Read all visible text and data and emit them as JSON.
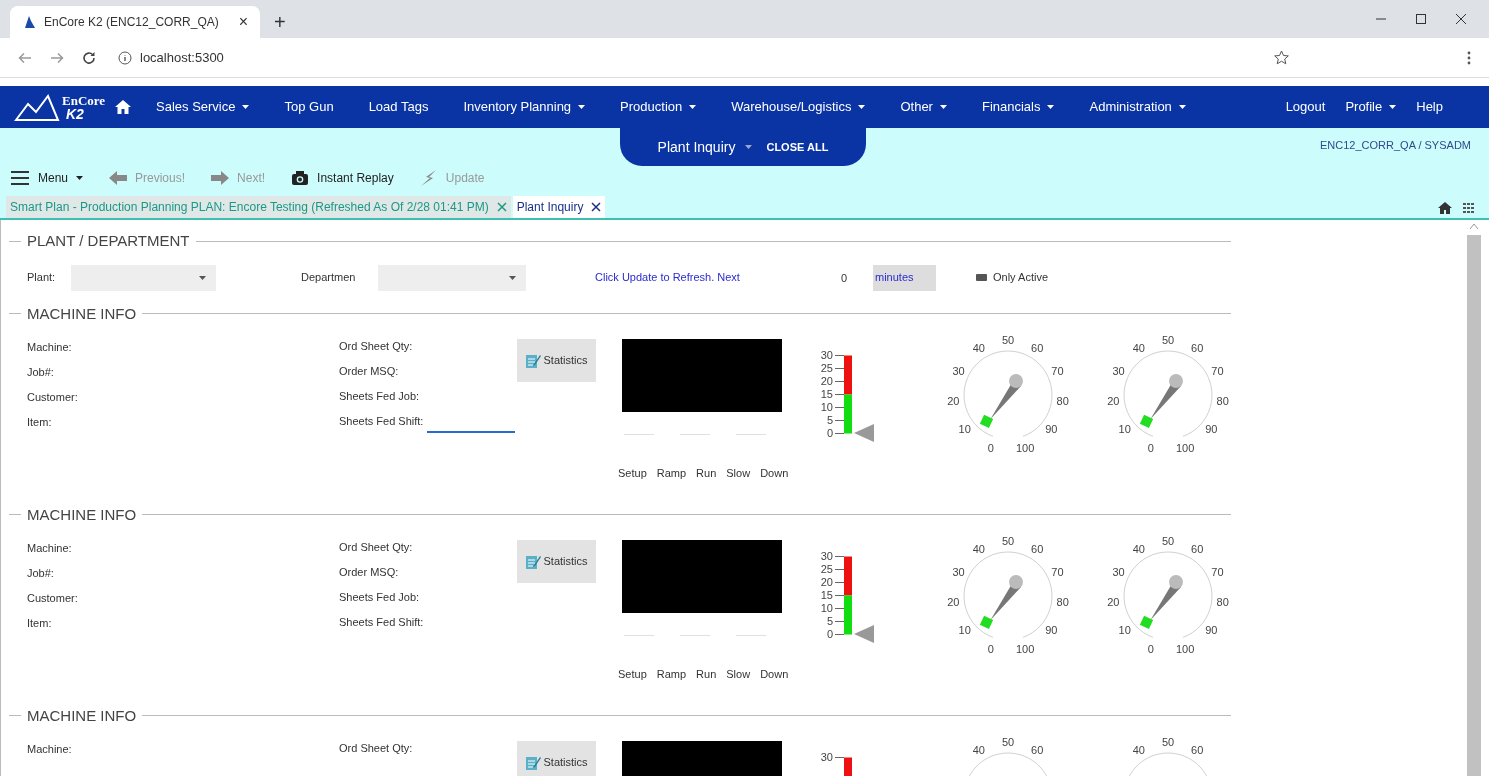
{
  "browser": {
    "tab_title": "EnCore K2 (ENC12_CORR_QA)",
    "tab_close": "×",
    "new_tab": "+",
    "address": "localhost:5300"
  },
  "nav": {
    "logo_text": "EnCore",
    "logo_sub": "K2",
    "items": [
      {
        "label": "Sales Service",
        "dropdown": true
      },
      {
        "label": "Top Gun",
        "dropdown": false
      },
      {
        "label": "Load Tags",
        "dropdown": false
      },
      {
        "label": "Inventory Planning",
        "dropdown": true
      },
      {
        "label": "Production",
        "dropdown": true
      },
      {
        "label": "Warehouse/Logistics",
        "dropdown": true
      },
      {
        "label": "Other",
        "dropdown": true
      },
      {
        "label": "Financials",
        "dropdown": true
      },
      {
        "label": "Administration",
        "dropdown": true
      }
    ],
    "right_items": [
      {
        "label": "Logout",
        "dropdown": false
      },
      {
        "label": "Profile",
        "dropdown": true
      },
      {
        "label": "Help",
        "dropdown": false
      }
    ]
  },
  "screen_pill": {
    "title": "Plant Inquiry",
    "close_all": "CLOSE ALL"
  },
  "user": "ENC12_CORR_QA / SYSADM",
  "toolbar": [
    {
      "kind": "menu",
      "label": "Menu",
      "disabled": false
    },
    {
      "kind": "previous",
      "label": "Previous!",
      "disabled": true
    },
    {
      "kind": "next",
      "label": "Next!",
      "disabled": true
    },
    {
      "kind": "camera",
      "label": "Instant Replay",
      "disabled": false
    },
    {
      "kind": "update",
      "label": "Update",
      "disabled": true
    }
  ],
  "tabs": [
    {
      "label": "Smart Plan - Production Planning PLAN: Encore Testing (Refreshed As Of 2/28 01:41 PM)",
      "selected": false
    },
    {
      "label": "Plant Inquiry",
      "selected": true
    }
  ],
  "plant_department": {
    "title": "PLANT / DEPARTMENT",
    "plant_label": "Plant:",
    "department_label": "Departmen",
    "refresh_link": "Click Update to Refresh. Next",
    "minutes_value": "0",
    "minutes_label": "minutes",
    "only_active": {
      "label": "Only Active",
      "checked": false
    }
  },
  "machine_sections": [
    {
      "title": "MACHINE INFO",
      "left_fields": [
        "Machine:",
        "Job#:",
        "Customer:",
        "Item:"
      ],
      "right_fields": [
        {
          "label": "Ord Sheet Qty:",
          "focused": false
        },
        {
          "label": "Order MSQ:",
          "focused": false
        },
        {
          "label": "Sheets Fed Job:",
          "focused": false
        },
        {
          "label": "Sheets Fed Shift:",
          "focused": true
        }
      ],
      "statistics_button": "Statistics",
      "phase_labels": [
        "Setup",
        "Ramp",
        "Run",
        "Slow",
        "Down"
      ],
      "level_gauge": {
        "ticks": [
          "30",
          "25",
          "20",
          "15",
          "10",
          "5",
          "0"
        ]
      },
      "dials": [
        {
          "ticks": [
            "0",
            "10",
            "20",
            "30",
            "40",
            "50",
            "60",
            "70",
            "80",
            "90",
            "100"
          ]
        },
        {
          "ticks": [
            "0",
            "10",
            "20",
            "30",
            "40",
            "50",
            "60",
            "70",
            "80",
            "90",
            "100"
          ]
        }
      ]
    },
    {
      "title": "MACHINE INFO",
      "left_fields": [
        "Machine:",
        "Job#:",
        "Customer:",
        "Item:"
      ],
      "right_fields": [
        {
          "label": "Ord Sheet Qty:",
          "focused": false
        },
        {
          "label": "Order MSQ:",
          "focused": false
        },
        {
          "label": "Sheets Fed Job:",
          "focused": false
        },
        {
          "label": "Sheets Fed Shift:",
          "focused": false
        }
      ],
      "statistics_button": "Statistics",
      "phase_labels": [
        "Setup",
        "Ramp",
        "Run",
        "Slow",
        "Down"
      ],
      "level_gauge": {
        "ticks": [
          "30",
          "25",
          "20",
          "15",
          "10",
          "5",
          "0"
        ]
      },
      "dials": [
        {
          "ticks": [
            "0",
            "10",
            "20",
            "30",
            "40",
            "50",
            "60",
            "70",
            "80",
            "90",
            "100"
          ]
        },
        {
          "ticks": [
            "0",
            "10",
            "20",
            "30",
            "40",
            "50",
            "60",
            "70",
            "80",
            "90",
            "100"
          ]
        }
      ]
    },
    {
      "title": "MACHINE INFO",
      "left_fields": [
        "Machine:"
      ],
      "right_fields": [
        {
          "label": "Ord Sheet Qty:",
          "focused": false
        }
      ],
      "statistics_button": "Statistics",
      "level_gauge": {
        "ticks": [
          "30"
        ]
      },
      "dials": [
        {
          "ticks": [
            "40",
            "50",
            "60"
          ]
        },
        {
          "ticks": [
            "40",
            "50",
            "60"
          ]
        }
      ]
    }
  ]
}
